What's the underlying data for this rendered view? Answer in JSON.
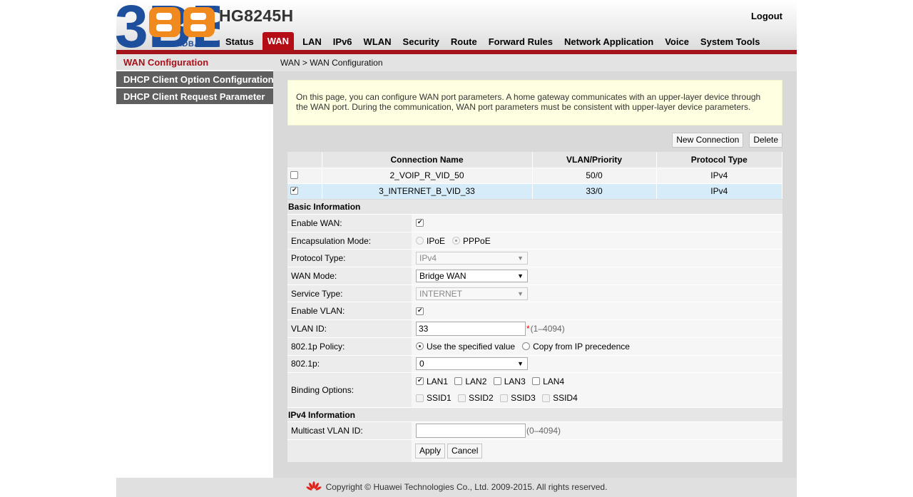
{
  "header": {
    "logo_main": "3BB",
    "logo_sub": "BROADBAND",
    "product": "HG8245H",
    "logout": "Logout"
  },
  "nav": {
    "tabs": [
      {
        "label": "Status",
        "active": false
      },
      {
        "label": "WAN",
        "active": true
      },
      {
        "label": "LAN",
        "active": false
      },
      {
        "label": "IPv6",
        "active": false
      },
      {
        "label": "WLAN",
        "active": false
      },
      {
        "label": "Security",
        "active": false
      },
      {
        "label": "Route",
        "active": false
      },
      {
        "label": "Forward Rules",
        "active": false
      },
      {
        "label": "Network Application",
        "active": false
      },
      {
        "label": "Voice",
        "active": false
      },
      {
        "label": "System Tools",
        "active": false
      }
    ]
  },
  "sidebar": {
    "items": [
      {
        "label": "WAN Configuration",
        "active": true
      },
      {
        "label": "DHCP Client Option Configuration",
        "active": false
      },
      {
        "label": "DHCP Client Request Parameter",
        "active": false
      }
    ]
  },
  "breadcrumb": "WAN > WAN Configuration",
  "notice": "On this page, you can configure WAN port parameters. A home gateway communicates with an upper-layer device through the WAN port. During the communication, WAN port parameters must be consistent with upper-layer device parameters.",
  "buttons": {
    "new_connection": "New Connection",
    "delete": "Delete"
  },
  "table": {
    "headers": [
      "",
      "Connection Name",
      "VLAN/Priority",
      "Protocol Type"
    ],
    "rows": [
      {
        "checked": false,
        "name": "2_VOIP_R_VID_50",
        "vlan": "50/0",
        "protocol": "IPv4"
      },
      {
        "checked": true,
        "name": "3_INTERNET_B_VID_33",
        "vlan": "33/0",
        "protocol": "IPv4"
      }
    ]
  },
  "basic": {
    "title": "Basic Information",
    "enable_wan_label": "Enable WAN:",
    "encap_label": "Encapsulation Mode:",
    "encap_ipoe": "IPoE",
    "encap_pppoe": "PPPoE",
    "protocol_label": "Protocol Type:",
    "protocol_value": "IPv4",
    "wan_mode_label": "WAN Mode:",
    "wan_mode_value": "Bridge WAN",
    "service_label": "Service Type:",
    "service_value": "INTERNET",
    "enable_vlan_label": "Enable VLAN:",
    "vlan_id_label": "VLAN ID:",
    "vlan_id_value": "33",
    "vlan_id_req": "*",
    "vlan_id_hint": "(1–4094)",
    "policy_label": "802.1p Policy:",
    "policy_specified": "Use the specified value",
    "policy_copy": "Copy from IP precedence",
    "p8021_label": "802.1p:",
    "p8021_value": "0",
    "binding_label": "Binding Options:",
    "lan": [
      {
        "label": "LAN1",
        "checked": true
      },
      {
        "label": "LAN2",
        "checked": false
      },
      {
        "label": "LAN3",
        "checked": false
      },
      {
        "label": "LAN4",
        "checked": false
      }
    ],
    "ssid": [
      {
        "label": "SSID1",
        "checked": false
      },
      {
        "label": "SSID2",
        "checked": false
      },
      {
        "label": "SSID3",
        "checked": false
      },
      {
        "label": "SSID4",
        "checked": false
      }
    ]
  },
  "ipv4": {
    "title": "IPv4 Information",
    "multicast_label": "Multicast VLAN ID:",
    "multicast_value": "",
    "multicast_hint": "(0–4094)"
  },
  "actions": {
    "apply": "Apply",
    "cancel": "Cancel"
  },
  "footer": {
    "copyright": "Copyright © Huawei Technologies Co., Ltd. 2009-2015. All rights reserved."
  },
  "colors": {
    "brand_red": "#a5121a",
    "logo_blue": "#1d4f9c",
    "logo_orange": "#f08a1e",
    "notice_bg": "#ffffe1",
    "selected_row": "#d7ecf9"
  }
}
